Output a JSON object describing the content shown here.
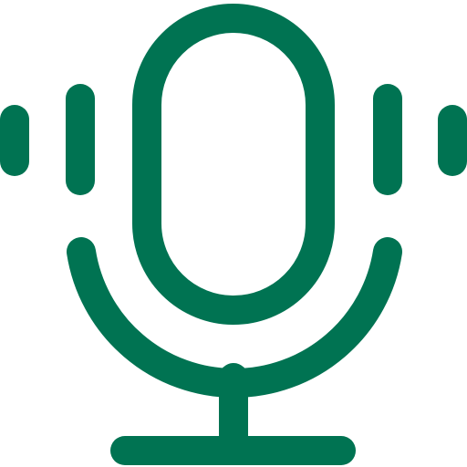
{
  "icon": {
    "name": "microphone-icon",
    "color": "#007352"
  }
}
